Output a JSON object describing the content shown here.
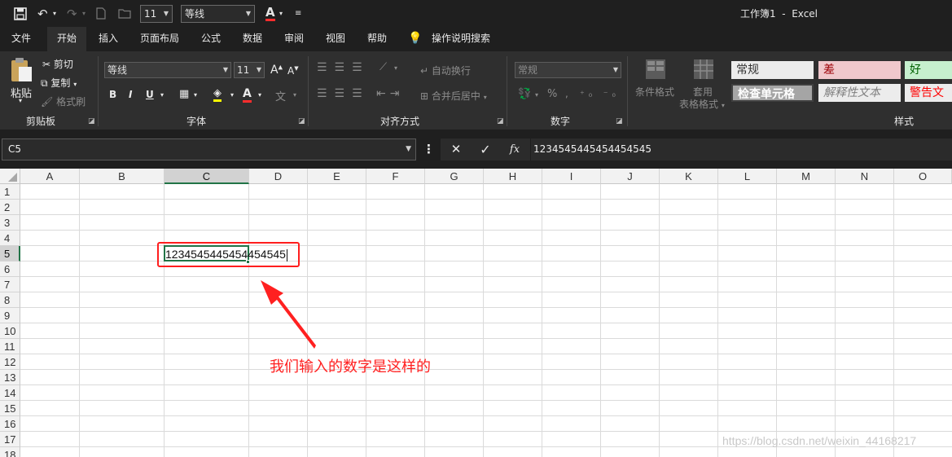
{
  "quick_access": {
    "save_icon": "save-icon",
    "undo_icon": "undo-icon",
    "redo_icon": "redo-icon",
    "font_size": "11",
    "font_name": "等线",
    "font_color_letter": "A"
  },
  "window": {
    "title": "工作簿1  -  Excel"
  },
  "tabs": [
    {
      "label": "文件"
    },
    {
      "label": "开始",
      "active": true
    },
    {
      "label": "插入"
    },
    {
      "label": "页面布局"
    },
    {
      "label": "公式"
    },
    {
      "label": "数据"
    },
    {
      "label": "审阅"
    },
    {
      "label": "视图"
    },
    {
      "label": "帮助"
    },
    {
      "label": "操作说明搜索"
    }
  ],
  "ribbon": {
    "clipboard": {
      "paste": "粘贴",
      "cut": "剪切",
      "copy": "复制",
      "format_painter": "格式刷",
      "group": "剪贴板"
    },
    "font": {
      "name": "等线",
      "size": "11",
      "bold": "B",
      "italic": "I",
      "underline": "U",
      "font_color": "A",
      "grow": "A",
      "shrink": "A",
      "group": "字体"
    },
    "alignment": {
      "wrap_text": "自动换行",
      "merge_center": "合并后居中",
      "group": "对齐方式"
    },
    "number": {
      "format": "常规",
      "percent": "%",
      "group": "数字"
    },
    "styles": {
      "conditional": "条件格式",
      "table_line1": "套用",
      "table_line2": "表格格式",
      "cell_normal": "常规",
      "cell_bad": "差",
      "cell_good": "好",
      "cell_check": "检查单元格",
      "cell_explanatory": "解释性文本",
      "cell_warning": "警告文本",
      "group": "样式"
    }
  },
  "formula_bar": {
    "name_box": "C5",
    "cancel": "✕",
    "enter": "✓",
    "fx": "fx",
    "content": "1234545445454454545"
  },
  "sheet": {
    "columns": [
      "A",
      "B",
      "C",
      "D",
      "E",
      "F",
      "G",
      "H",
      "I",
      "J",
      "K",
      "L",
      "M",
      "N",
      "O"
    ],
    "rows": [
      "1",
      "2",
      "3",
      "4",
      "5",
      "6",
      "7",
      "8",
      "9",
      "10",
      "11",
      "12",
      "13",
      "14",
      "15",
      "16",
      "17",
      "18"
    ],
    "active_cell": "C5",
    "editing_value": "1234545445454454545"
  },
  "annotation": {
    "text": "我们输入的数字是这样的",
    "color": "#ff2020"
  },
  "watermark": "https://blog.csdn.net/weixin_44168217",
  "colors": {
    "ribbon_bg": "#2f2f2f",
    "title_bg": "#1f1f1f",
    "selection": "#217346",
    "annotation": "#ff1e1e"
  }
}
